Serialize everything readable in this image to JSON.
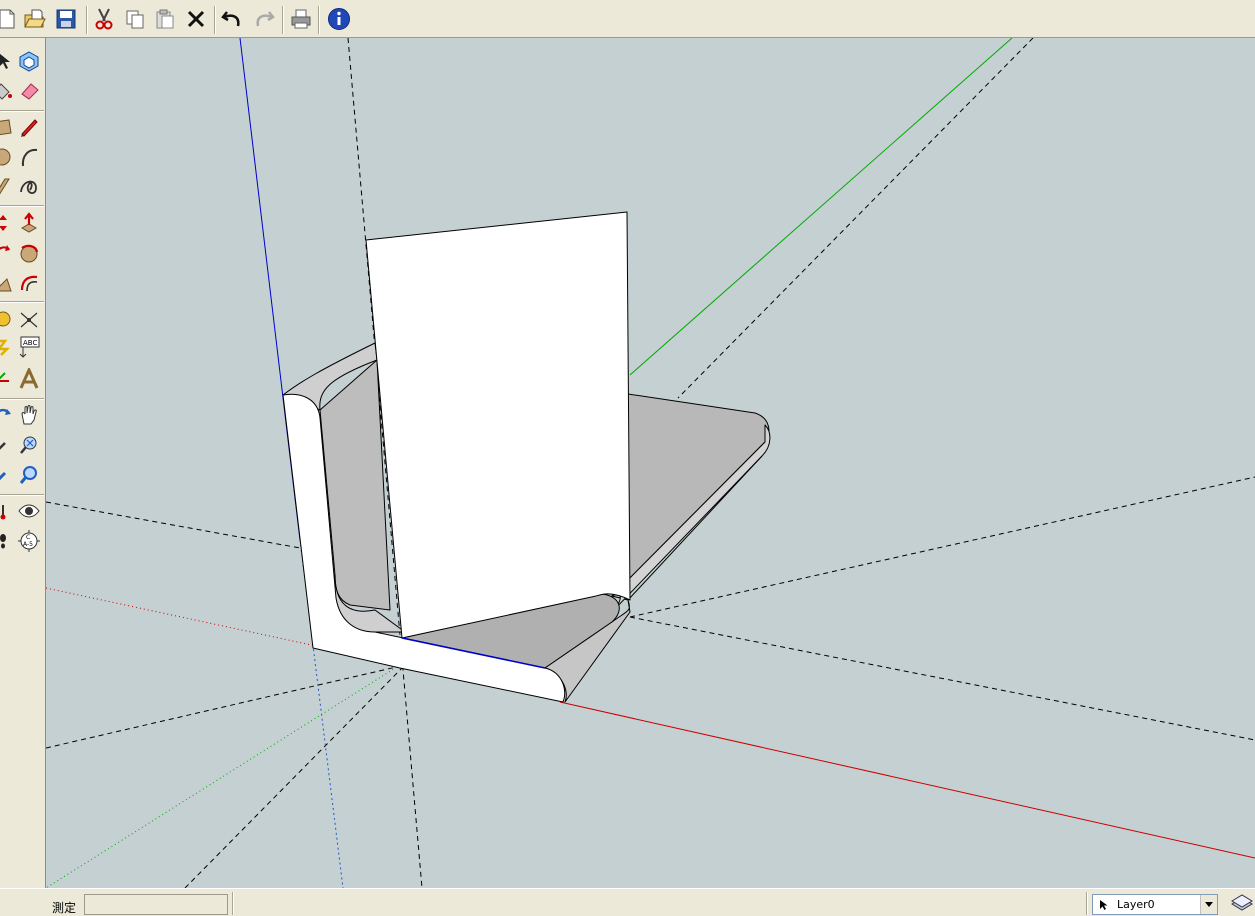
{
  "toolbar": {
    "buttons": [
      "new-icon",
      "open-icon",
      "save-icon",
      "cut-icon",
      "copy-icon",
      "paste-icon",
      "erase-icon",
      "undo-icon",
      "redo-icon",
      "print-icon",
      "model-info-icon"
    ]
  },
  "tools": [
    "select-icon",
    "component-icon",
    "paint-bucket-icon",
    "eraser-icon",
    "rectangle-icon",
    "pencil-icon",
    "circle-icon",
    "arc-icon",
    "polygon-icon",
    "freehand-icon",
    "move-icon",
    "push-pull-icon",
    "rotate-icon",
    "follow-me-icon",
    "scale-icon",
    "offset-icon",
    "tape-measure-icon",
    "dimension-icon",
    "protractor-icon",
    "text-icon",
    "axes-icon",
    "3d-text-icon",
    "orbit-icon",
    "pan-icon",
    "zoom-icon",
    "zoom-window-icon",
    "zoom-extents-icon",
    "previous-icon",
    "position-camera-icon",
    "look-around-icon",
    "walk-icon",
    "section-plane-icon"
  ],
  "status": {
    "measure_label": "測定",
    "measure_value": "",
    "layer_name": "Layer0"
  },
  "colors": {
    "viewport_bg": "#c4d0d2",
    "axis_red": "#cc0000",
    "axis_green": "#00aa00",
    "axis_blue": "#0000cc",
    "chrome": "#ece9d8"
  }
}
